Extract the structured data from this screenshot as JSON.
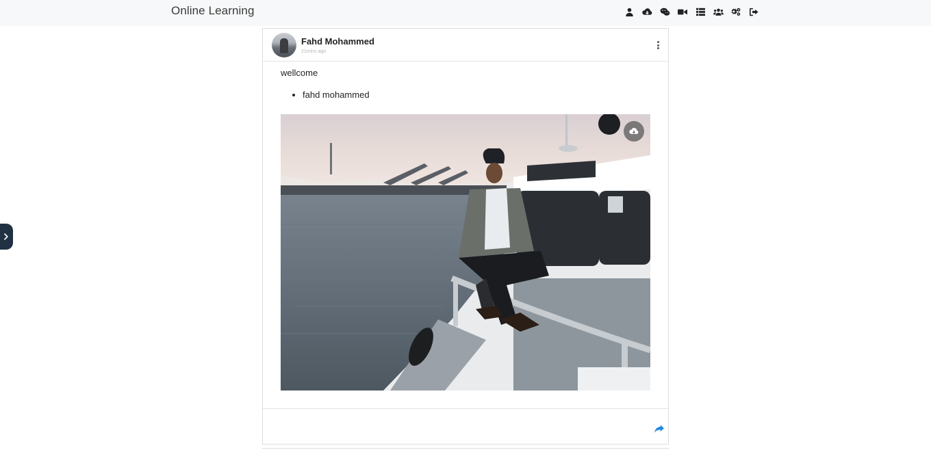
{
  "app": {
    "brand": "Online Learning"
  },
  "nav": {
    "icons": [
      "user-icon",
      "cloud-download-icon",
      "wechat-icon",
      "video-camera-icon",
      "list-icon",
      "users-icon",
      "gears-icon",
      "sign-out-icon"
    ]
  },
  "post": {
    "author": "Fahd Mohammed",
    "time": "21mins ago",
    "text": "wellcome",
    "list_items": [
      "fahd mohammed"
    ],
    "image_alt": "photo"
  },
  "colors": {
    "navbar_bg": "#f7f8f9",
    "side_toggle_bg": "#1f3142",
    "share_accent": "#1e88e5"
  }
}
